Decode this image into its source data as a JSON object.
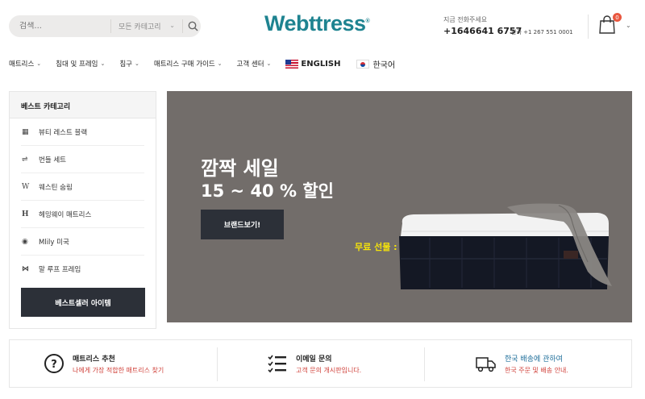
{
  "search": {
    "placeholder": "검색...",
    "category": "모든 카테고리"
  },
  "brand": {
    "logo_text": "Webttress",
    "registered": "®"
  },
  "contact": {
    "label": "지금 전화주세요",
    "phone": "+1646641 6757",
    "sub": "한국 +1 267 551 0001"
  },
  "cart": {
    "count": "0"
  },
  "nav": {
    "items": [
      {
        "label": "매트리스"
      },
      {
        "label": "침대 및 프레임"
      },
      {
        "label": "침구"
      },
      {
        "label": "매트리스 구매 가이드"
      },
      {
        "label": "고객 센터"
      }
    ],
    "lang_en": "ENGLISH",
    "lang_ko": "한국어"
  },
  "sidebar": {
    "title": "베스트 카테고리",
    "items": [
      {
        "label": "뷰티 레스트 블랙",
        "icon": "bed-icon"
      },
      {
        "label": "번들 세트",
        "icon": "bed-frame-icon"
      },
      {
        "label": "웨스틴 숨림",
        "icon": "w-brand-icon"
      },
      {
        "label": "헤밍웨이 매트리스",
        "icon": "h-brand-icon"
      },
      {
        "label": "Mlily 미국",
        "icon": "mlily-brand-icon"
      },
      {
        "label": "말 루프 프레임",
        "icon": "m-brand-icon"
      }
    ],
    "button": "베스트셀러 아이템"
  },
  "hero": {
    "title": "깜짝 세일",
    "subtitle": "15 ~ 40 % 할인",
    "button": "브랜드보기!",
    "gift": "무료 선물 : 매트리스 보호기",
    "background": "#726d6a"
  },
  "features": [
    {
      "title": "매트리스 추천",
      "sub": "나에게 가장 적합한 매트리스 찾기",
      "icon": "question-circle-icon"
    },
    {
      "title": "이메일 문의",
      "sub": "고객 문의 개시판입니다.",
      "icon": "checklist-icon"
    },
    {
      "title": "한국 배송에 관하여",
      "sub": "한국 주문 및 배송 안내.",
      "icon": "delivery-truck-icon"
    }
  ],
  "colors": {
    "brand": "#1e8390",
    "dark_button": "#2c3038",
    "gift_text": "#f6e40a",
    "feature_sub": "#d0413a",
    "badge": "#e9573f"
  }
}
